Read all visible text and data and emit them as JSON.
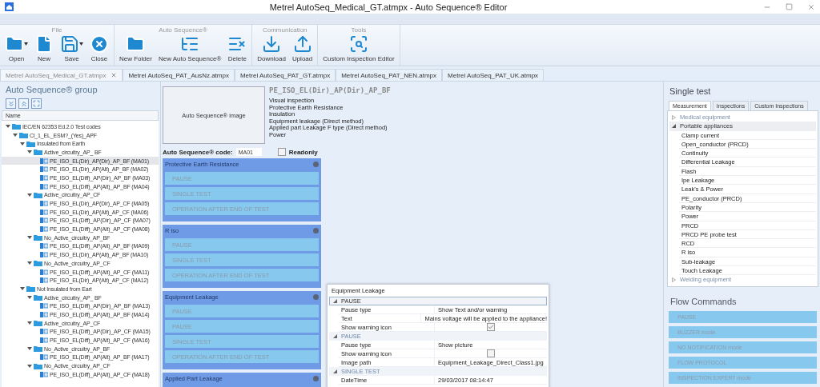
{
  "window": {
    "title": "Metrel AutoSeq_Medical_GT.atmpx - Auto Sequence® Editor"
  },
  "ribbon": {
    "groups": [
      {
        "label": "File",
        "buttons": [
          {
            "label": "Open",
            "kind": "open",
            "dropdown": true
          },
          {
            "label": "New",
            "kind": "new",
            "dropdown": false
          },
          {
            "label": "Save",
            "kind": "save",
            "dropdown": true
          },
          {
            "label": "Close",
            "kind": "close",
            "dropdown": false
          }
        ]
      },
      {
        "label": "Auto Sequence®",
        "buttons": [
          {
            "label": "New Folder",
            "kind": "folder",
            "dropdown": false
          },
          {
            "label": "New Auto Sequence®",
            "kind": "sequence",
            "dropdown": false
          },
          {
            "label": "Delete",
            "kind": "delete",
            "dropdown": false
          }
        ]
      },
      {
        "label": "Communication",
        "buttons": [
          {
            "label": "Download",
            "kind": "download",
            "dropdown": false
          },
          {
            "label": "Upload",
            "kind": "upload",
            "dropdown": false
          }
        ]
      },
      {
        "label": "Tools",
        "buttons": [
          {
            "label": "Custom Inspection Editor",
            "kind": "inspect",
            "dropdown": false
          }
        ]
      }
    ]
  },
  "document_tabs": [
    {
      "label": "Metrel AutoSeq_Medical_GT.atmpx",
      "selected": true
    },
    {
      "label": "Metrel AutoSeq_PAT_AusNz.atmpx",
      "selected": false
    },
    {
      "label": "Metrel AutoSeq_PAT_GT.atmpx",
      "selected": false
    },
    {
      "label": "Metrel AutoSeq_PAT_NEN.atmpx",
      "selected": false
    },
    {
      "label": "Metrel AutoSeq_PAT_UK.atmpx",
      "selected": false
    }
  ],
  "sequence_group": {
    "title": "Auto Sequence® group",
    "column": "Name",
    "tree": [
      {
        "label": "IEC/EN 62353 Ed.2.0 Test codes",
        "kind": "folder",
        "expanded": true,
        "selected": false,
        "children": [
          {
            "label": "Cl_1_EL_ESM?_(Yes)_APF",
            "kind": "folder",
            "expanded": true,
            "selected": false,
            "children": [
              {
                "label": "Insulated from Earth",
                "kind": "folder",
                "expanded": true,
                "selected": false,
                "children": [
                  {
                    "label": "Active_circuitry_AP_ BF",
                    "kind": "folder",
                    "expanded": true,
                    "selected": false,
                    "children": [
                      {
                        "label": "PE_ISO_EL(Dir)_AP(Dir)_AP_BF (MA01)",
                        "kind": "sequence",
                        "selected": true
                      },
                      {
                        "label": "PE_ISO_EL(Dir)_AP(Alt)_AP_BF (MA02)",
                        "kind": "sequence",
                        "selected": false
                      },
                      {
                        "label": "PE_ISO_EL(Diff)_AP(Dir)_AP_BF (MA03)",
                        "kind": "sequence",
                        "selected": false
                      },
                      {
                        "label": "PE_ISO_EL(Diff)_AP(Alt)_AP_BF (MA04)",
                        "kind": "sequence",
                        "selected": false
                      }
                    ]
                  },
                  {
                    "label": "Active_circuitry_AP_CF",
                    "kind": "folder",
                    "expanded": true,
                    "selected": false,
                    "children": [
                      {
                        "label": "PE_ISO_EL(Dir)_AP(Dir)_AP_CF (MA05)",
                        "kind": "sequence",
                        "selected": false
                      },
                      {
                        "label": "PE_ISO_EL(Dir)_AP(Alt)_AP_CF (MA06)",
                        "kind": "sequence",
                        "selected": false
                      },
                      {
                        "label": "PE_ISO_EL(Diff)_AP(Dir)_AP_CF (MA07)",
                        "kind": "sequence",
                        "selected": false
                      },
                      {
                        "label": "PE_ISO_EL(Diff)_AP(Alt)_AP_CF (MA08)",
                        "kind": "sequence",
                        "selected": false
                      }
                    ]
                  },
                  {
                    "label": "No_Active_circuitry_AP_BF",
                    "kind": "folder",
                    "expanded": true,
                    "selected": false,
                    "children": [
                      {
                        "label": "PE_ISO_EL(Diff)_AP(Alt)_AP_BF (MA09)",
                        "kind": "sequence",
                        "selected": false
                      },
                      {
                        "label": "PE_ISO_EL(Dir)_AP(Alt)_AP_BF (MA10)",
                        "kind": "sequence",
                        "selected": false
                      }
                    ]
                  },
                  {
                    "label": "No_Active_circuitry_AP_CF",
                    "kind": "folder",
                    "expanded": true,
                    "selected": false,
                    "children": [
                      {
                        "label": "PE_ISO_EL(Diff)_AP(Alt)_AP_CF (MA11)",
                        "kind": "sequence",
                        "selected": false
                      },
                      {
                        "label": "PE_ISO_EL(Dir)_AP(Alt)_AP_CF (MA12)",
                        "kind": "sequence",
                        "selected": false
                      }
                    ]
                  }
                ]
              },
              {
                "label": "Not Insulated from Eart",
                "kind": "folder",
                "expanded": true,
                "selected": false,
                "children": [
                  {
                    "label": "Active_circuitry_AP_ BF",
                    "kind": "folder",
                    "expanded": true,
                    "selected": false,
                    "children": [
                      {
                        "label": "PE_ISO_EL(Diff)_AP(Dir)_AP_BF (MA13)",
                        "kind": "sequence",
                        "selected": false
                      },
                      {
                        "label": "PE_ISO_EL(Diff)_AP(Alt)_AP_BF (MA14)",
                        "kind": "sequence",
                        "selected": false
                      }
                    ]
                  },
                  {
                    "label": "Active_circuitry_AP_CF",
                    "kind": "folder",
                    "expanded": true,
                    "selected": false,
                    "children": [
                      {
                        "label": "PE_ISO_EL(Diff)_AP(Dir)_AP_CF (MA15)",
                        "kind": "sequence",
                        "selected": false
                      },
                      {
                        "label": "PE_ISO_EL(Diff)_AP(Alt)_AP_CF (MA16)",
                        "kind": "sequence",
                        "selected": false
                      }
                    ]
                  },
                  {
                    "label": "No_Active_circuitry_AP_BF",
                    "kind": "folder",
                    "expanded": true,
                    "selected": false,
                    "children": [
                      {
                        "label": "PE_ISO_EL(Diff)_AP(Alt)_AP_BF (MA17)",
                        "kind": "sequence",
                        "selected": false
                      }
                    ]
                  },
                  {
                    "label": "No_Active_circuitry_AP_CF",
                    "kind": "folder",
                    "expanded": true,
                    "selected": false,
                    "children": [
                      {
                        "label": "PE_ISO_EL(Diff)_AP(Alt)_AP_CF (MA18)",
                        "kind": "sequence",
                        "selected": false
                      }
                    ]
                  }
                ]
              }
            ]
          }
        ]
      }
    ]
  },
  "editor": {
    "image_placeholder": "Auto Sequence® image",
    "name": "PE_ISO_EL(Dir)_AP(Dir)_AP_BF",
    "tests": [
      "Visual inspection",
      "Protective Earth Resistance",
      "Insulation",
      "Equipment leakage (Direct method)",
      "Applied part Leakage F type (Direct method)",
      "Power"
    ],
    "code_label": "Auto Sequence® code:",
    "code_value": "MA01",
    "readonly": {
      "label": "Readonly",
      "checked": false
    },
    "blocks": [
      {
        "title": "Protective Earth Resistance",
        "steps": [
          "PAUSE",
          "SINGLE TEST",
          "OPERATION AFTER END OF TEST"
        ]
      },
      {
        "title": "R iso",
        "steps": [
          "PAUSE",
          "SINGLE TEST",
          "OPERATION AFTER END OF TEST"
        ]
      },
      {
        "title": "Equipment Leakage",
        "steps": [
          "PAUSE",
          "PAUSE",
          "SINGLE TEST",
          "OPERATION AFTER END OF TEST"
        ]
      },
      {
        "title": "Applied Part Leakage"
      }
    ]
  },
  "properties": {
    "title": "Equipment Leakage",
    "sections": [
      {
        "title": "PAUSE",
        "expanded": true,
        "selected": true,
        "rows": [
          {
            "name": "Pause type",
            "kind": "text",
            "value": "Show Text and/or warning"
          },
          {
            "name": "Text",
            "kind": "text",
            "value": "Mains voltage will be applied to the appliance!"
          },
          {
            "name": "Show warning icon",
            "kind": "checkbox",
            "checked": true
          }
        ]
      },
      {
        "title": "PAUSE",
        "expanded": true,
        "selected": false,
        "rows": [
          {
            "name": "Pause type",
            "kind": "text",
            "value": "Show picture"
          },
          {
            "name": "Show warning icon",
            "kind": "checkbox",
            "checked": false
          },
          {
            "name": "Image path",
            "kind": "text",
            "value": "Equipment_Leakage_Direct_Class1.jpg"
          }
        ]
      },
      {
        "title": "SINGLE TEST",
        "expanded": true,
        "selected": false,
        "rows": [
          {
            "name": "DateTime",
            "kind": "text",
            "value": "29/03/2017 08:14:47"
          }
        ]
      }
    ]
  },
  "single_test": {
    "title": "Single test",
    "tabs": [
      {
        "label": "Measurement",
        "selected": true
      },
      {
        "label": "Inspections",
        "selected": false
      },
      {
        "label": "Custom Inspections",
        "selected": false
      }
    ],
    "groups": [
      {
        "label": "Medical equipment",
        "expanded": false,
        "selected": false
      },
      {
        "label": "Portable appliances",
        "expanded": true,
        "selected": true,
        "items": [
          "Clamp current",
          "Open_conductor (PRCD)",
          "Continuity",
          "Differential Leakage",
          "Flash",
          "Ipe Leakage",
          "Leak's & Power",
          "PE_conductor (PRCD)",
          "Polarity",
          "Power",
          "PRCD",
          "PRCD PE probe test",
          "RCD",
          "R iso",
          "Sub-leakage",
          "Touch Leakage"
        ]
      },
      {
        "label": "Welding equipment",
        "expanded": false,
        "selected": false
      }
    ]
  },
  "flow_commands": {
    "title": "Flow Commands",
    "items": [
      "PAUSE",
      "BUZZER mode",
      "NO NOTIFICATION mode",
      "FLOW PROTOCOL",
      "INSPECTION EXPERT mode"
    ]
  }
}
